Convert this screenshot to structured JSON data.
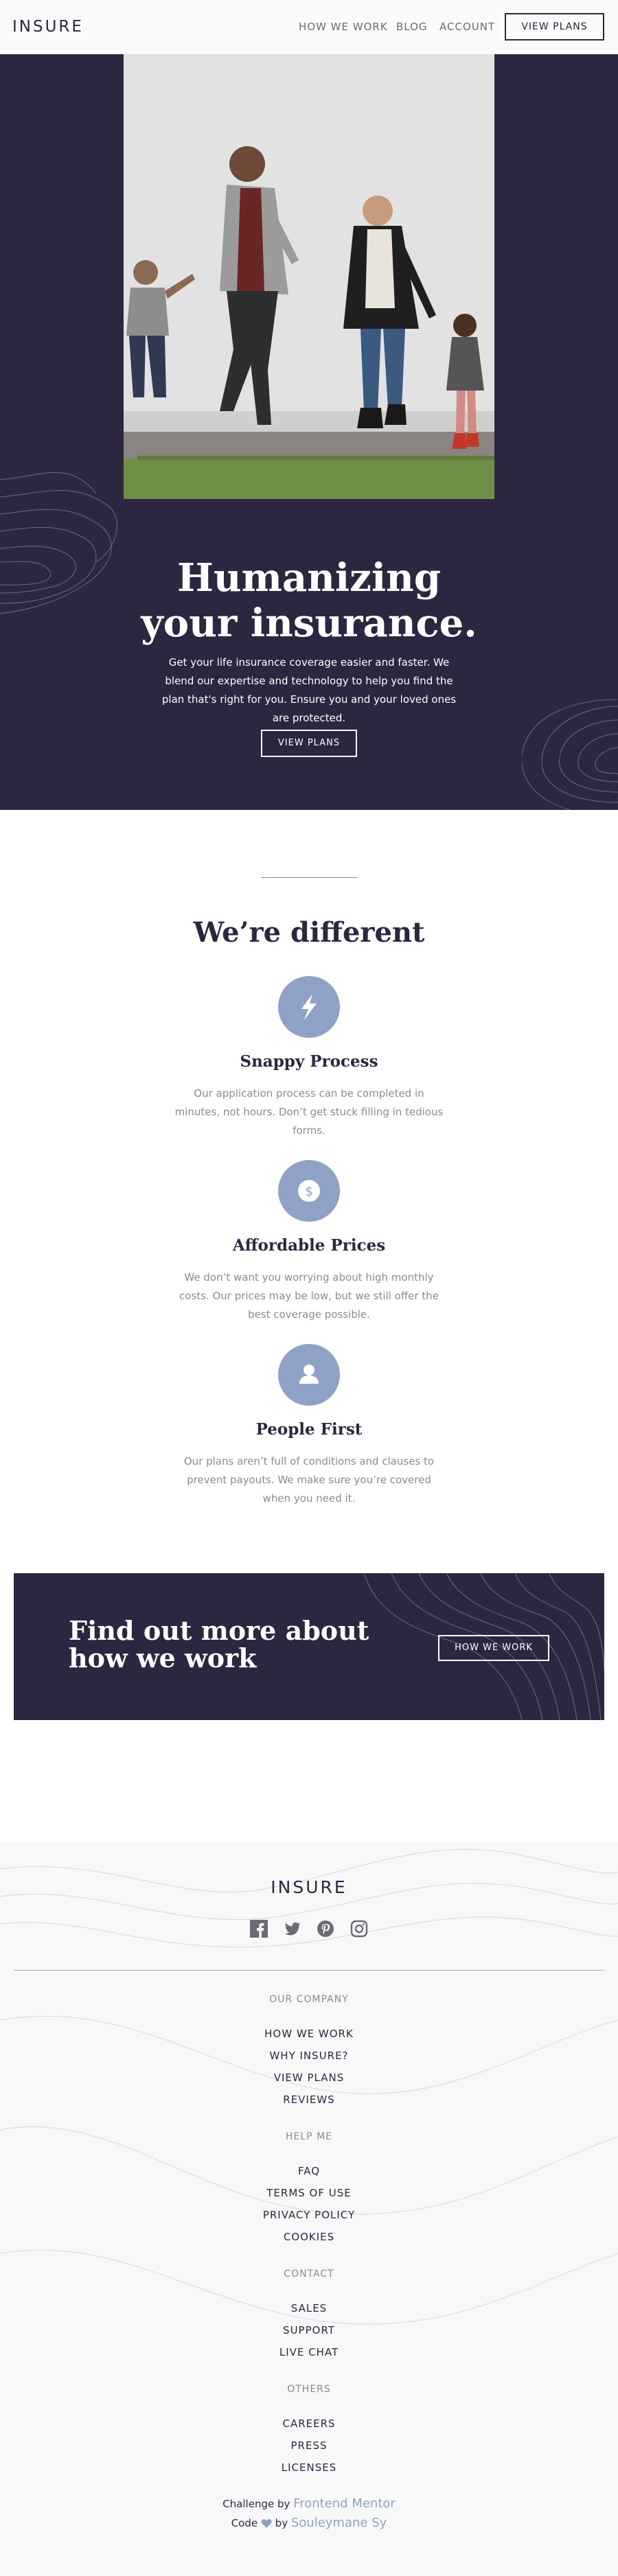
{
  "header": {
    "logo": "INSURE",
    "nav": [
      "HOW WE WORK",
      "BLOG",
      "ACCOUNT"
    ],
    "cta": "VIEW PLANS"
  },
  "hero": {
    "title_line1": "Humanizing",
    "title_line2": "your insurance.",
    "text": "Get your life insurance coverage easier and faster. We blend our expertise and technology to help you find the plan that's right for you. Ensure you and your loved ones are protected.",
    "button": "VIEW PLANS"
  },
  "different": {
    "title": "We’re different",
    "features": [
      {
        "title": "Snappy Process",
        "text": "Our application process can be completed in minutes, not hours. Don’t get stuck filling in tedious forms.",
        "icon": "lightning-icon"
      },
      {
        "title": "Affordable Prices",
        "text": "We don’t want you worrying about high monthly costs. Our prices may be low, but we still offer the best coverage possible.",
        "icon": "dollar-icon"
      },
      {
        "title": "People First",
        "text": "Our plans aren’t full of conditions and clauses to prevent payouts. We make sure you’re covered when you need it.",
        "icon": "person-icon"
      }
    ]
  },
  "cta_banner": {
    "title": "Find out more about how we work",
    "button": "HOW WE WORK"
  },
  "footer": {
    "logo": "INSURE",
    "socials": [
      "facebook-icon",
      "twitter-icon",
      "pinterest-icon",
      "instagram-icon"
    ],
    "sections": [
      {
        "heading": "OUR COMPANY",
        "links": [
          "HOW WE WORK",
          "WHY INSURE?",
          "VIEW PLANS",
          "REVIEWS"
        ]
      },
      {
        "heading": "HELP ME",
        "links": [
          "FAQ",
          "TERMS OF USE",
          "PRIVACY POLICY",
          "COOKIES"
        ]
      },
      {
        "heading": "CONTACT",
        "links": [
          "SALES",
          "SUPPORT",
          "LIVE CHAT"
        ]
      },
      {
        "heading": "OTHERS",
        "links": [
          "CAREERS",
          "PRESS",
          "LICENSES"
        ]
      }
    ],
    "attribution": {
      "challenge_prefix": "Challenge by",
      "challenge_link": "Frontend Mentor",
      "code_prefix": "Code",
      "code_by": "by",
      "code_link": "Souleymane Sy"
    }
  },
  "colors": {
    "dark_violet": "#2c2640",
    "accent_blue": "#8fa2c5",
    "grey_text": "#8c8797"
  }
}
